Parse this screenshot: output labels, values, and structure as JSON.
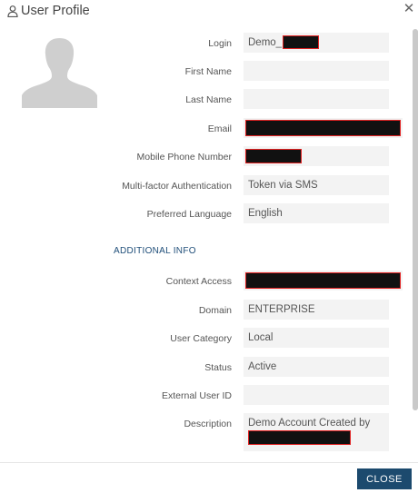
{
  "dialog": {
    "title": "User Profile",
    "close_icon": "close-icon",
    "user_icon": "user-icon"
  },
  "avatar": {
    "icon": "avatar-silhouette-icon"
  },
  "fields": {
    "login": {
      "label": "Login",
      "value": "Demo_"
    },
    "first_name": {
      "label": "First Name",
      "value": ""
    },
    "last_name": {
      "label": "Last Name",
      "value": ""
    },
    "email": {
      "label": "Email",
      "value": ""
    },
    "mobile_phone": {
      "label": "Mobile Phone Number",
      "value": ""
    },
    "mfa": {
      "label": "Multi-factor Authentication",
      "value": "Token via SMS"
    },
    "preferred_language": {
      "label": "Preferred Language",
      "value": "English"
    }
  },
  "additional_info": {
    "section_title": "ADDITIONAL INFO",
    "context_access": {
      "label": "Context Access",
      "value": ""
    },
    "domain": {
      "label": "Domain",
      "value": "ENTERPRISE"
    },
    "user_category": {
      "label": "User Category",
      "value": "Local"
    },
    "status": {
      "label": "Status",
      "value": "Active"
    },
    "external_user_id": {
      "label": "External User ID",
      "value": ""
    },
    "description": {
      "label": "Description",
      "value": "Demo Account Created by"
    }
  },
  "footer": {
    "close_label": "CLOSE"
  },
  "colors": {
    "primary_button": "#1c4a6e",
    "section_title": "#1f4e79",
    "redaction_border": "#e02020",
    "field_background": "#f3f3f3"
  }
}
